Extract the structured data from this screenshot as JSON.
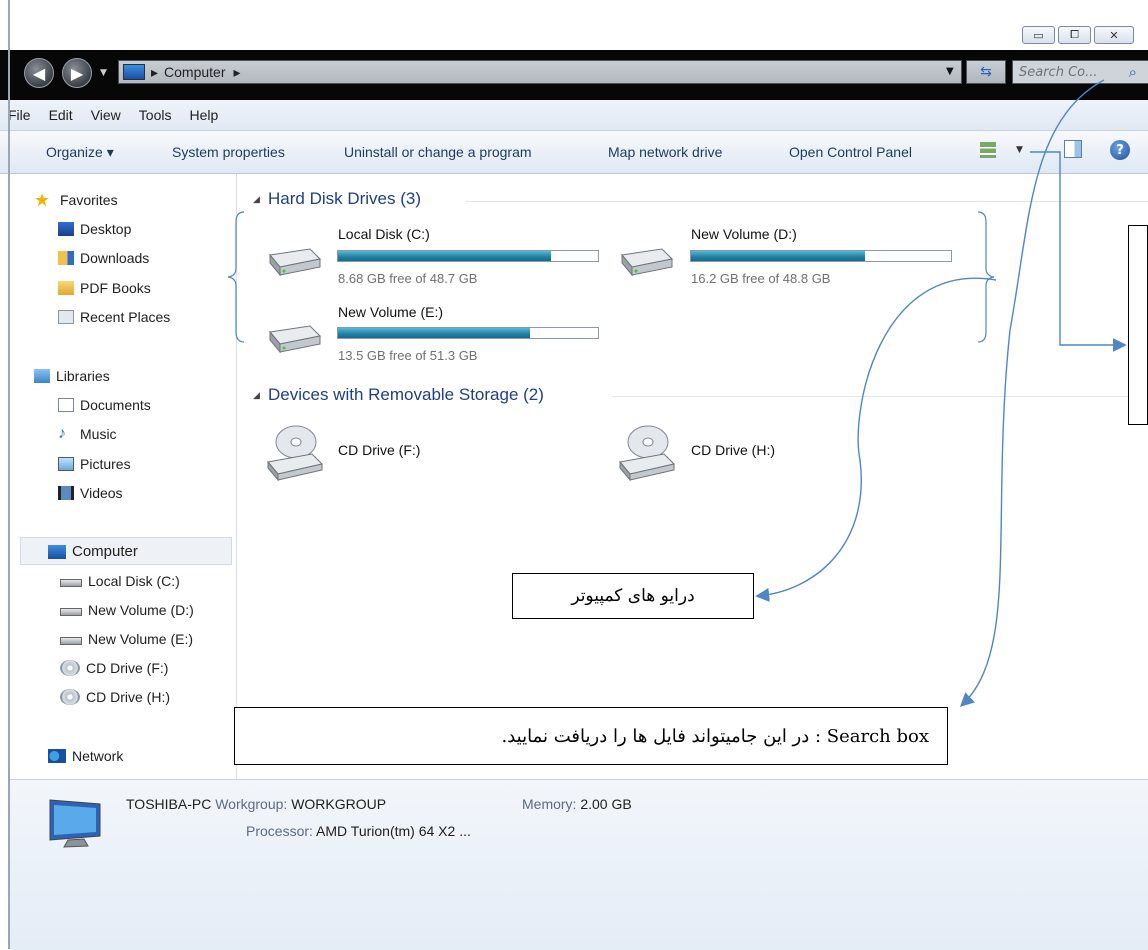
{
  "window": {
    "min_symbol": "▭",
    "max_symbol": "⧠",
    "close_symbol": "✕"
  },
  "address": {
    "path_sep": "▸",
    "location": "Computer",
    "trail_sep": "▸",
    "search_placeholder": "Search Co..."
  },
  "menu": [
    "File",
    "Edit",
    "View",
    "Tools",
    "Help"
  ],
  "toolbar": {
    "organize": "Organize ▾",
    "system_properties": "System properties",
    "uninstall": "Uninstall or change a program",
    "map_drive": "Map network drive",
    "control_panel": "Open Control Panel"
  },
  "nav": {
    "favorites": "Favorites",
    "desktop": "Desktop",
    "downloads": "Downloads",
    "pdf_books": "PDF Books",
    "recent_places": "Recent Places",
    "libraries": "Libraries",
    "documents": "Documents",
    "music": "Music",
    "pictures": "Pictures",
    "videos": "Videos",
    "computer": "Computer",
    "local_c": "Local Disk (C:)",
    "vol_d": "New Volume (D:)",
    "vol_e": "New Volume (E:)",
    "cd_f": "CD Drive (F:)",
    "cd_h": "CD Drive (H:)",
    "network": "Network"
  },
  "sections": {
    "hdd": "Hard Disk Drives (3)",
    "removable": "Devices with Removable Storage (2)"
  },
  "drives": {
    "c": {
      "name": "Local Disk (C:)",
      "free": "8.68 GB free of 48.7 GB",
      "used_fraction": 0.82
    },
    "d": {
      "name": "New Volume (D:)",
      "free": "16.2 GB free of 48.8 GB",
      "used_fraction": 0.67
    },
    "e": {
      "name": "New Volume (E:)",
      "free": "13.5 GB free of 51.3 GB",
      "used_fraction": 0.74
    },
    "f": {
      "name": "CD Drive (F:)"
    },
    "h": {
      "name": "CD Drive (H:)"
    }
  },
  "annotations": {
    "drives_note": "درایو های کمپیوتر",
    "search_note": "Search box : در این جامیتواند فایل ها را دریافت نمایید."
  },
  "details": {
    "pc_name": "TOSHIBA-PC",
    "workgroup_label": "Workgroup:",
    "workgroup": "WORKGROUP",
    "memory_label": "Memory:",
    "memory": "2.00 GB",
    "processor_label": "Processor:",
    "processor": "AMD Turion(tm) 64 X2 ..."
  }
}
